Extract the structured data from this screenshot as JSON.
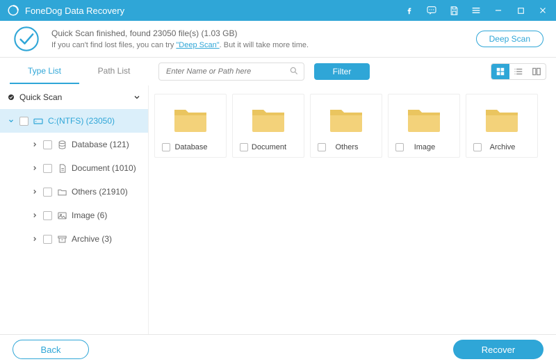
{
  "titlebar": {
    "app_name": "FoneDog Data Recovery"
  },
  "status": {
    "line1_prefix": "Quick Scan finished, found ",
    "file_count": "23050",
    "line1_suffix": " file(s) (1.03 GB)",
    "line2_prefix": "If you can't find lost files, you can try ",
    "deep_scan_link": "\"Deep Scan\"",
    "line2_suffix": ". But it will take more time.",
    "deep_scan_button": "Deep Scan"
  },
  "tabs": {
    "type_list": "Type List",
    "path_list": "Path List"
  },
  "search": {
    "placeholder": "Enter Name or Path here"
  },
  "filter_label": "Filter",
  "tree": {
    "root": "Quick Scan",
    "drive": "C:(NTFS) (23050)",
    "children": [
      {
        "label": "Database (121)"
      },
      {
        "label": "Document (1010)"
      },
      {
        "label": "Others (21910)"
      },
      {
        "label": "Image (6)"
      },
      {
        "label": "Archive (3)"
      }
    ]
  },
  "folders": [
    {
      "name": "Database"
    },
    {
      "name": "Document"
    },
    {
      "name": "Others"
    },
    {
      "name": "Image"
    },
    {
      "name": "Archive"
    }
  ],
  "footer": {
    "back": "Back",
    "recover": "Recover"
  }
}
